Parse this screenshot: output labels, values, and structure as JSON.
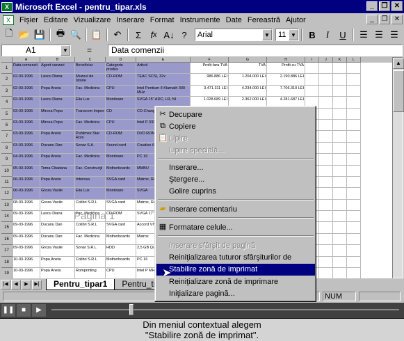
{
  "window": {
    "title": "Microsoft Excel - pentru_tipar.xls"
  },
  "menubar": [
    "Fișier",
    "Editare",
    "Vizualizare",
    "Inserare",
    "Format",
    "Instrumente",
    "Date",
    "Fereastră",
    "Ajutor"
  ],
  "toolbar": {
    "font": "Arial",
    "size": "11",
    "bold": "B",
    "italic": "I",
    "underline": "U"
  },
  "formula": {
    "cell": "A1",
    "fx": "=",
    "content": "Data comenzii"
  },
  "columns": [
    "A",
    "B",
    "C",
    "D",
    "E",
    "F",
    "G",
    "H",
    "I",
    "J",
    "K",
    "L"
  ],
  "rows": [
    "1",
    "2",
    "3",
    "4",
    "5",
    "6",
    "7",
    "8",
    "9",
    "10",
    "11",
    "12",
    "13",
    "14",
    "15",
    "16",
    "17",
    "18",
    "19",
    "20",
    "21",
    "22"
  ],
  "headers": [
    "Data comenzii",
    "Agent vanzari",
    "Beneficiar",
    "Categorie produs",
    "Articol",
    "Profit fara TVA",
    "TVA",
    "Profit cu TVA"
  ],
  "table": [
    [
      "02-03-1996",
      "Lascu Diana",
      "Muzeul de Istorie",
      "CD-ROM",
      "TEAC SCSI, 32x",
      "986.886 LEI",
      "1.204.000 LEI",
      "2.190.886 LEI"
    ],
    [
      "02-03-1996",
      "Popa Aneta",
      "Fac. Medicina",
      "CPU",
      "Intel Pentium II Klamath 300 MHz",
      "3.471.311 LEI",
      "4.234.000 LEI",
      "7.706.310 LEI"
    ],
    [
      "02-03-1996",
      "Lascu Diana",
      "Elia Lux",
      "Monitoare",
      "SVGA 15\" ADC, LR, NI",
      "1.028.689 LEI",
      "2.362.000 LEI",
      "4.281.687 LEI"
    ],
    [
      "03-03-1996",
      "Mircea Popa",
      "Transcom Impex",
      "CD",
      "CD-Changer",
      "",
      "",
      ""
    ],
    [
      "03-03-1996",
      "Mircea Popa",
      "Fac. Medicina",
      "CPU",
      "Intel P 333 MHz",
      "",
      "",
      ""
    ],
    [
      "03-03-1996",
      "Popa Aneta",
      "Publimex Star Rom",
      "CD-ROM",
      "DVD ROM",
      "",
      "",
      ""
    ],
    [
      "03-03-1996",
      "Ducanu Dan",
      "Sonar S.A.",
      "Sound card",
      "Creative 64 S12",
      "",
      "",
      ""
    ],
    [
      "04-03-1996",
      "Popa Aneta",
      "Fac. Medicina",
      "Monitoare",
      "PC 16",
      "",
      "",
      ""
    ],
    [
      "05-03-1996",
      "Toma Citadana",
      "Fac. Construcţii",
      "Motherboards",
      "MMBU",
      "",
      "",
      ""
    ],
    [
      "06-03-1996",
      "Popa Aneta",
      "Intersaa",
      "SVGA card",
      "Matrox, RAM",
      "",
      "",
      ""
    ],
    [
      "06-03-1996",
      "Groza Vasile",
      "Elia Lux",
      "Monitoare",
      "SVGA",
      "",
      "",
      ""
    ],
    [
      "08-03-1996",
      "Groza Vasile",
      "Colibri S.R.L",
      "SVGA card",
      "Matrox, RAM",
      "",
      "",
      ""
    ],
    [
      "09-03-1996",
      "Lascu Diana",
      "Fac. Medicina",
      "CD-ROM",
      "SVGA 17\"",
      "",
      "",
      ""
    ],
    [
      "09-03-1996",
      "Ducanu Dan",
      "Colibri S.R.L",
      "SVGA card",
      "Accord VIV",
      "",
      "",
      ""
    ],
    [
      "09-03-1996",
      "Ducanu Dan",
      "Fac. Medicina",
      "Motherboards",
      "Matrox",
      "",
      "",
      ""
    ],
    [
      "09-03-1996",
      "Groza Vasile",
      "Sonar S.R.L",
      "HDD",
      "2,5 GB Quantum",
      "",
      "",
      ""
    ],
    [
      "10-03-1996",
      "Popa Aneta",
      "Colibri S.R.L",
      "Motherboards",
      "PC 16",
      "",
      "",
      ""
    ],
    [
      "10-03-1996",
      "Popa Aneta",
      "Romprinting",
      "CPU",
      "Intel P MHz",
      "",
      "",
      ""
    ],
    [
      "10-03-1996",
      "Toma Citadana",
      "Fac. Medicina",
      "Motherboards",
      "Accord",
      "",
      "",
      ""
    ],
    [
      "13-03-1996",
      "Popa Aneta",
      "Dynarock",
      "CPU",
      "Intel P MHz",
      "",
      "",
      ""
    ],
    [
      "13-03-1996",
      "Groza Vasile",
      "Colibri S.R.L",
      "SVGA card",
      "Accord",
      "",
      "",
      ""
    ]
  ],
  "watermark": "Pagina 1",
  "tabs": [
    "Pentru_tipar1",
    "Pentru_tipar2"
  ],
  "status": {
    "num": "NUM"
  },
  "context_menu": {
    "items": [
      {
        "label": "Decupare",
        "icon": "scissors-icon",
        "enabled": true
      },
      {
        "label": "Copiere",
        "icon": "copy-icon",
        "enabled": true
      },
      {
        "label": "Lipire",
        "icon": "paste-icon",
        "enabled": false
      },
      {
        "label": "Lipire specială...",
        "icon": "",
        "enabled": false
      },
      {
        "label": "Inserare...",
        "icon": "",
        "enabled": true
      },
      {
        "label": "Ştergere...",
        "icon": "",
        "enabled": true
      },
      {
        "label": "Golire cuprins",
        "icon": "",
        "enabled": true
      },
      {
        "label": "Inserare comentariu",
        "icon": "comment-icon",
        "enabled": true
      },
      {
        "label": "Formatare celule...",
        "icon": "format-cells-icon",
        "enabled": true
      },
      {
        "label": "Inserare sfârşit de pagină",
        "icon": "",
        "enabled": false
      },
      {
        "label": "Reiniţializarea tuturor sfârşiturilor de pagină",
        "icon": "",
        "enabled": true
      },
      {
        "label": "Stabilire zonă de imprimat",
        "icon": "",
        "enabled": true,
        "highlighted": true
      },
      {
        "label": "Reiniţializare zonă de imprimare",
        "icon": "",
        "enabled": true
      },
      {
        "label": "Iniţializare pagină...",
        "icon": "",
        "enabled": true
      }
    ]
  },
  "caption": {
    "line1": "Din meniul contextual alegem",
    "line2": "\"Stabilire zonă de imprimat\"."
  },
  "colors": {
    "title": "#000080",
    "selection": "#9999cc",
    "highlight": "#000080"
  }
}
